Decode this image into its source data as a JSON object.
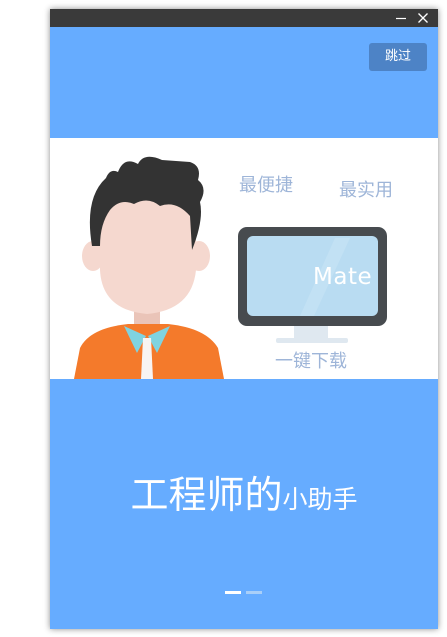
{
  "window": {
    "minimize_icon": "minimize-icon",
    "close_icon": "close-icon",
    "skip_label": "跳过"
  },
  "illustration": {
    "features": [
      "最便捷",
      "最实用",
      "一键下载"
    ],
    "screen_text": "Mate"
  },
  "tagline": {
    "main": "工程师的",
    "sub": "小助手"
  },
  "pager": {
    "pages": 2,
    "current": 1
  },
  "colors": {
    "background": "#66acff",
    "titlebar": "#3a3a3a",
    "skip_button": "#4d83c6",
    "feature_text": "#9eb5d8",
    "shirt": "#f47a2b",
    "collar": "#7fd3e0",
    "hair": "#333333",
    "skin": "#f5d8cf"
  }
}
